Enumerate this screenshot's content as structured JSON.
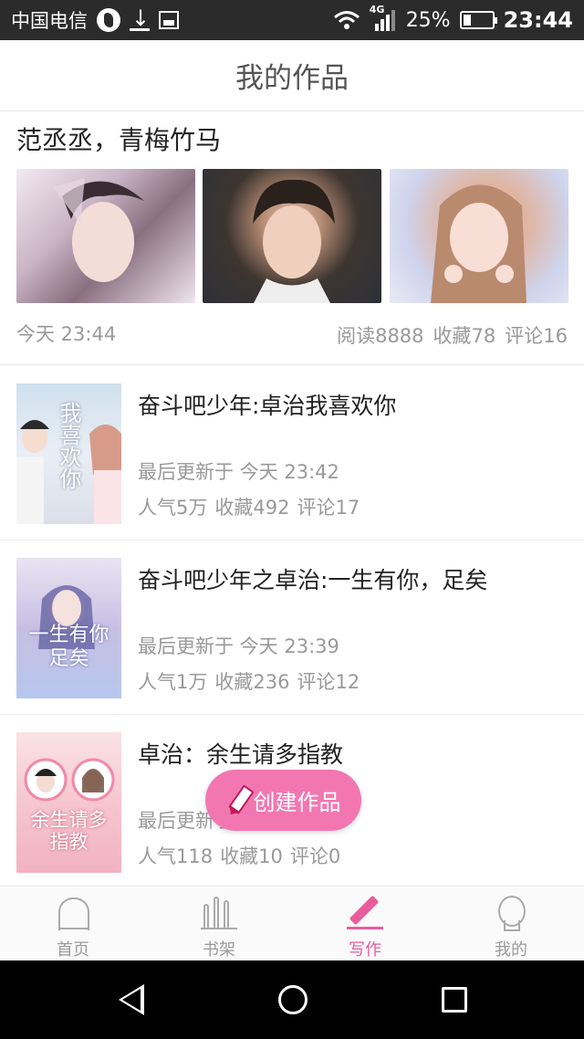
{
  "status_bar": {
    "carrier": "中国电信",
    "network": "4G",
    "battery": "25%",
    "time": "23:44",
    "icons": [
      "globe-icon",
      "download-icon",
      "image-icon",
      "wifi-icon",
      "signal-icon",
      "battery-icon"
    ]
  },
  "header": {
    "title": "我的作品"
  },
  "featured": {
    "title": "范丞丞，青梅竹马",
    "images": [
      "featured-image-1",
      "featured-image-2",
      "featured-image-3"
    ],
    "time": "今天 23:44",
    "reads": "阅读8888",
    "favorites": "收藏78",
    "comments": "评论16"
  },
  "works": [
    {
      "title": "奋斗吧少年:卓治我喜欢你",
      "updated": "最后更新于 今天 23:42",
      "popularity": "人气5万",
      "favorites": "收藏492",
      "comments": "评论17",
      "cover_text": "我喜欢你"
    },
    {
      "title": "奋斗吧少年之卓治:一生有你，足矣",
      "updated": "最后更新于 今天 23:39",
      "popularity": "人气1万",
      "favorites": "收藏236",
      "comments": "评论12",
      "cover_text": "一生有你足矣"
    },
    {
      "title": "卓治：余生请多指教",
      "updated": "最后更新于 今天 23:38",
      "popularity": "人气118",
      "favorites": "收藏10",
      "comments": "评论0",
      "cover_text": "余生请多指教"
    }
  ],
  "fab": {
    "label": "创建作品",
    "icon": "pencil-icon"
  },
  "tabs": [
    {
      "label": "首页",
      "icon": "home-icon"
    },
    {
      "label": "书架",
      "icon": "bookshelf-icon"
    },
    {
      "label": "写作",
      "icon": "pen-icon",
      "active": true
    },
    {
      "label": "我的",
      "icon": "profile-icon"
    }
  ],
  "colors": {
    "accent": "#e85c9c",
    "fab": "#f277b1",
    "status_bar": "#2b2b2b"
  }
}
